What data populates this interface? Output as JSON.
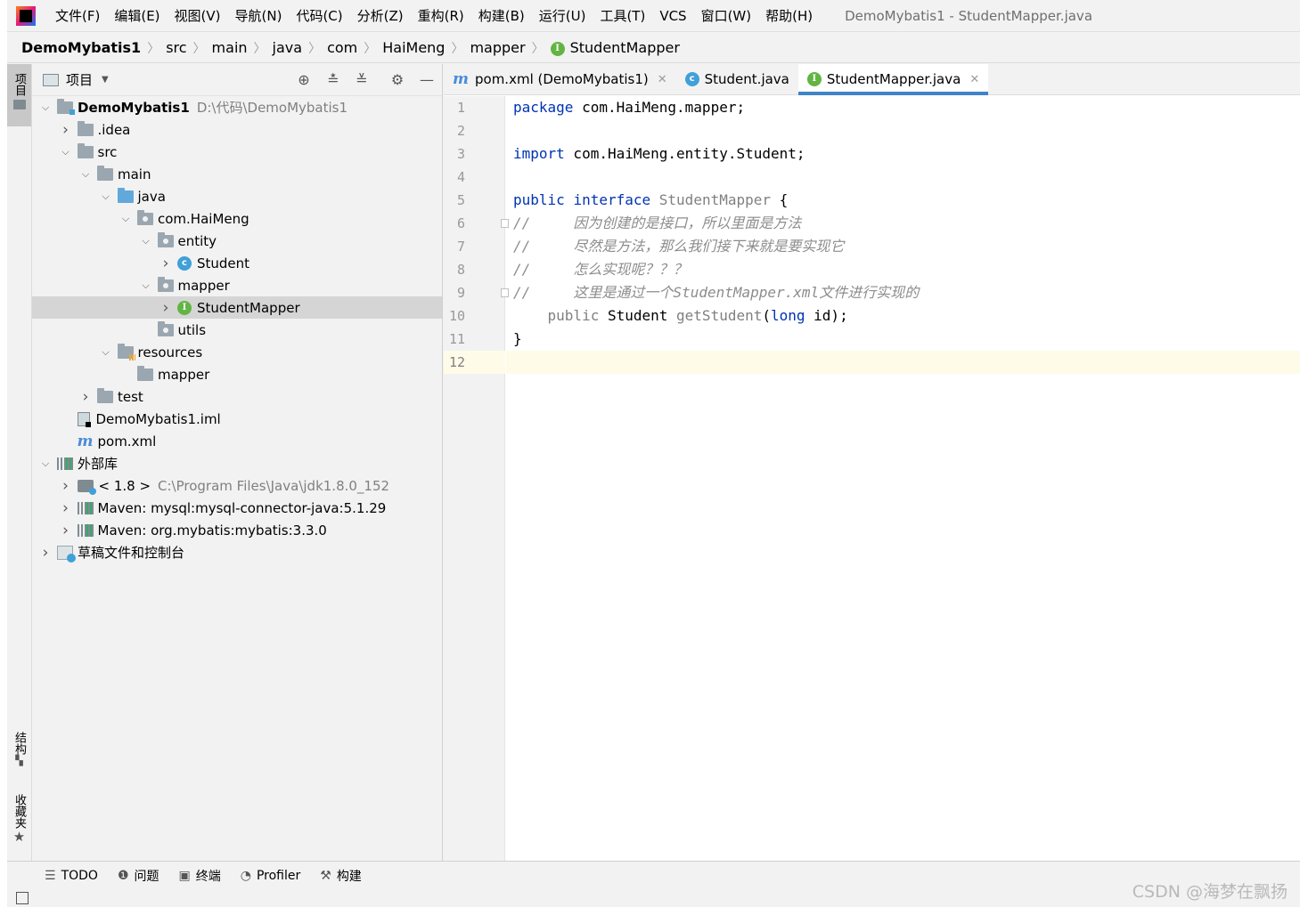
{
  "menu": {
    "items": [
      "文件(F)",
      "编辑(E)",
      "视图(V)",
      "导航(N)",
      "代码(C)",
      "分析(Z)",
      "重构(R)",
      "构建(B)",
      "运行(U)",
      "工具(T)",
      "VCS",
      "窗口(W)",
      "帮助(H)"
    ],
    "window_title": "DemoMybatis1 - StudentMapper.java"
  },
  "breadcrumb": {
    "items": [
      "DemoMybatis1",
      "src",
      "main",
      "java",
      "com",
      "HaiMeng",
      "mapper",
      "StudentMapper"
    ]
  },
  "left_stripe": {
    "project_label": "项目",
    "structure_label": "结构",
    "favorites_label": "收藏夹"
  },
  "project_panel": {
    "title": "项目",
    "tree": [
      {
        "label": "DemoMybatis1",
        "hint": "D:\\代码\\DemoMybatis1",
        "depth": 0,
        "expanded": true,
        "icon": "module-folder-icon",
        "bold": true
      },
      {
        "label": ".idea",
        "depth": 1,
        "expanded": false,
        "icon": "folder-icon"
      },
      {
        "label": "src",
        "depth": 1,
        "expanded": true,
        "icon": "folder-icon"
      },
      {
        "label": "main",
        "depth": 2,
        "expanded": true,
        "icon": "folder-icon"
      },
      {
        "label": "java",
        "depth": 3,
        "expanded": true,
        "icon": "source-folder-icon"
      },
      {
        "label": "com.HaiMeng",
        "depth": 4,
        "expanded": true,
        "icon": "package-icon"
      },
      {
        "label": "entity",
        "depth": 5,
        "expanded": true,
        "icon": "package-icon"
      },
      {
        "label": "Student",
        "depth": 6,
        "expanded": false,
        "icon": "class-icon"
      },
      {
        "label": "mapper",
        "depth": 5,
        "expanded": true,
        "icon": "package-icon"
      },
      {
        "label": "StudentMapper",
        "depth": 6,
        "expanded": false,
        "icon": "interface-icon",
        "selected": true
      },
      {
        "label": "utils",
        "depth": 5,
        "leaf": true,
        "icon": "package-icon"
      },
      {
        "label": "resources",
        "depth": 3,
        "expanded": true,
        "icon": "resources-folder-icon"
      },
      {
        "label": "mapper",
        "depth": 4,
        "leaf": true,
        "icon": "folder-icon"
      },
      {
        "label": "test",
        "depth": 2,
        "expanded": false,
        "icon": "folder-icon"
      },
      {
        "label": "DemoMybatis1.iml",
        "depth": 1,
        "leaf": true,
        "icon": "iml-file-icon"
      },
      {
        "label": "pom.xml",
        "depth": 1,
        "leaf": true,
        "icon": "maven-icon"
      },
      {
        "label": "外部库",
        "depth": 0,
        "expanded": true,
        "icon": "library-icon"
      },
      {
        "label": "< 1.8 >",
        "hint": "C:\\Program Files\\Java\\jdk1.8.0_152",
        "depth": 1,
        "expanded": false,
        "icon": "jdk-icon"
      },
      {
        "label": "Maven: mysql:mysql-connector-java:5.1.29",
        "depth": 1,
        "expanded": false,
        "icon": "maven-library-icon"
      },
      {
        "label": "Maven: org.mybatis:mybatis:3.3.0",
        "depth": 1,
        "expanded": false,
        "icon": "maven-library-icon"
      },
      {
        "label": "草稿文件和控制台",
        "depth": 0,
        "expanded": false,
        "icon": "scratches-icon"
      }
    ]
  },
  "editor": {
    "tabs": [
      {
        "label": "pom.xml (DemoMybatis1)",
        "icon": "maven-icon",
        "active": false
      },
      {
        "label": "Student.java",
        "icon": "class-icon",
        "active": false
      },
      {
        "label": "StudentMapper.java",
        "icon": "interface-icon",
        "active": true
      }
    ],
    "line_numbers": [
      "1",
      "2",
      "3",
      "4",
      "5",
      "6",
      "7",
      "8",
      "9",
      "10",
      "11",
      "12"
    ],
    "current_line": 12,
    "code": {
      "l1_kw": "package",
      "l1_rest": " com.HaiMeng.mapper;",
      "l3_kw": "import",
      "l3_rest": " com.HaiMeng.entity.Student;",
      "l5_kw1": "public",
      "l5_kw2": "interface",
      "l5_name": "StudentMapper",
      "l5_rest": " {",
      "l6": "//     因为创建的是接口，所以里面是方法",
      "l7": "//     尽然是方法，那么我们接下来就是要实现它",
      "l8": "//     怎么实现呢？？？",
      "l9": "//     这里是通过一个StudentMapper.xml文件进行实现的",
      "l10_indent": "    ",
      "l10_kw": "public",
      "l10_type": " Student ",
      "l10_method": "getStudent",
      "l10_paren": "(",
      "l10_ptype": "long",
      "l10_rest": " id);",
      "l11": "}"
    }
  },
  "bottom_tools": [
    {
      "label": "TODO",
      "icon": "list-icon"
    },
    {
      "label": "问题",
      "icon": "info-icon"
    },
    {
      "label": "终端",
      "icon": "terminal-icon"
    },
    {
      "label": "Profiler",
      "icon": "profiler-icon"
    },
    {
      "label": "构建",
      "icon": "hammer-icon"
    }
  ],
  "watermark": "CSDN @海梦在飘扬"
}
